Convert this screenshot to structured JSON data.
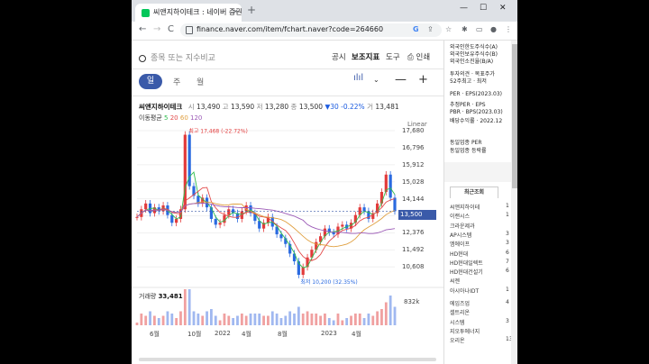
{
  "browser": {
    "tab_title": "씨앤지하이테크 : 네이버 증권",
    "url": "finance.naver.com/item/fchart.naver?code=264660",
    "new_tab": "+",
    "tab_close": "×",
    "win_min": "—",
    "win_max": "☐",
    "win_close": "✕",
    "back": "←",
    "forward": "→",
    "reload": "C"
  },
  "chart_header": {
    "search_placeholder": "종목 또는 지수비교",
    "menu": [
      "공시",
      "보조지표",
      "도구",
      "인쇄"
    ],
    "periods": [
      "일",
      "주",
      "월"
    ],
    "stock_name": "씨앤지하이테크",
    "open_label": "시",
    "open": "13,490",
    "high_label": "고",
    "high": "13,590",
    "low_label": "저",
    "low": "13,280",
    "close_label": "종",
    "close": "13,500",
    "change": "▼30 -0.22%",
    "volume_label": "거",
    "volume": "13,481",
    "ma_title": "이동평균",
    "ma": [
      "5",
      "20",
      "60",
      "120"
    ],
    "ma_colors": [
      "#2ebd4e",
      "#e24a4a",
      "#e0a040",
      "#9b59b6"
    ],
    "scale": "Linear"
  },
  "chart_data": {
    "type": "line",
    "y_axis": [
      17680,
      16796,
      15912,
      15028,
      14144,
      13260,
      12376,
      11492,
      10608
    ],
    "ylim": [
      10200,
      17680
    ],
    "x_labels": [
      "6월",
      "10월",
      "2022",
      "4월",
      "8월",
      "2023",
      "4월"
    ],
    "max_label": "최고 17,468 (-22.72%)",
    "min_label": "최저 10,200 (32.35%)",
    "current_price": "13,500",
    "volume_label": "거래량",
    "volume_value": "33,481",
    "volume_axis": "832k",
    "close_series": [
      13200,
      13600,
      13900,
      13400,
      13700,
      13500,
      13800,
      13300,
      12900,
      13100,
      13600,
      17468,
      14800,
      14300,
      13900,
      14200,
      13700,
      13100,
      12800,
      12900,
      13300,
      13600,
      13400,
      13100,
      13500,
      13800,
      13400,
      13000,
      12600,
      12900,
      13200,
      12700,
      12300,
      12100,
      11800,
      11300,
      10900,
      10200,
      10600,
      11100,
      11500,
      11900,
      12200,
      12600,
      12400,
      12300,
      12700,
      12800,
      12600,
      12900,
      13300,
      13700,
      13500,
      13100,
      13400,
      13900,
      14500,
      15400,
      14200,
      13500
    ]
  },
  "sidebar": {
    "items_top": [
      "외국인한도주식수(A)",
      "외국인보유주식수(B)",
      "외국인소진율(B/A)",
      "투자의견 · 목표주가",
      "52주최고 · 최저",
      "PER · EPS(2023.03)",
      "추정PER · EPS",
      "PBR · BPS(2023.03)",
      "배당수익률 · 2022.12",
      "동일업종 PER",
      "동일업종 등락률"
    ],
    "recent_title": "최근조회",
    "recent": [
      "씨앤지하이테",
      "이랜시스",
      "크라운제과",
      "AP시스템",
      "엠에이프",
      "HD현대",
      "HD현대일렉트",
      "HD현대건설기",
      "씨젠",
      "아시아나IDT",
      "에임즈업",
      "셀트리온",
      "시스템",
      "지오투에너지",
      "오리온"
    ],
    "recent_nums": [
      "1",
      "1",
      "",
      "3",
      "3",
      "6",
      "7",
      "6",
      "",
      "1",
      "4",
      "",
      "3",
      "",
      "13"
    ]
  }
}
